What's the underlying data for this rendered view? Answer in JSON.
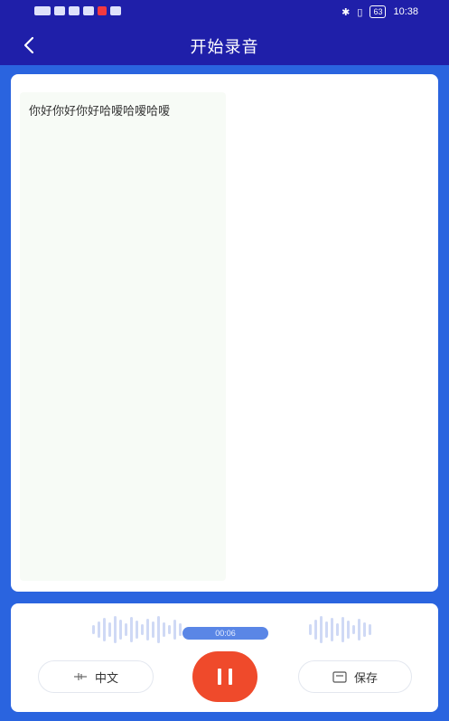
{
  "status_bar": {
    "time": "10:38",
    "battery": "63"
  },
  "header": {
    "title": "开始录音"
  },
  "transcript": {
    "text": "你好你好你好哈嗳哈嗳哈嗳"
  },
  "recorder": {
    "timer": "00:06",
    "language_label": "中文",
    "save_label": "保存"
  },
  "colors": {
    "header_bg": "#1f1fa9",
    "page_bg": "#2a64df",
    "record_button": "#ef4a2b",
    "timer_pill": "#5a86e6"
  },
  "icons": {
    "back": "chevron-left-icon",
    "language": "waveform-icon",
    "save": "save-box-icon",
    "pause": "pause-icon"
  }
}
